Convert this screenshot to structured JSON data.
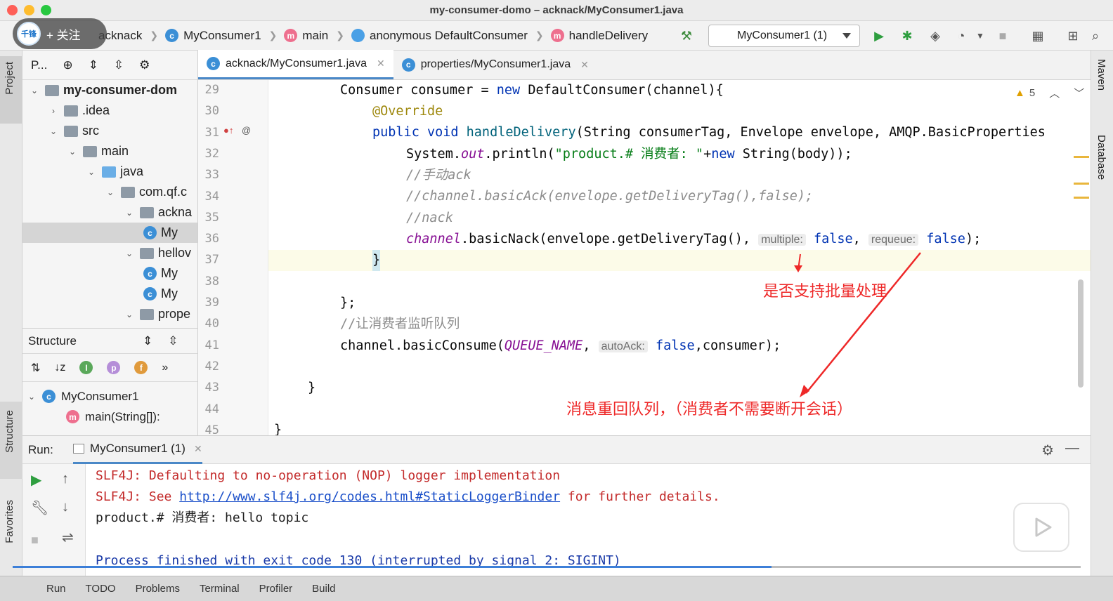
{
  "window": {
    "title": "my-consumer-domo – acknack/MyConsumer1.java"
  },
  "overlay": {
    "follow_label": "+ 关注",
    "avatar_text": "千锋"
  },
  "navbar": {
    "breadcrumbs": [
      {
        "label": "acknack",
        "icon": "folder-icon"
      },
      {
        "label": "MyConsumer1",
        "icon": "class-icon"
      },
      {
        "label": "main",
        "icon": "method-icon"
      },
      {
        "label": "anonymous DefaultConsumer",
        "icon": "anonymous-class-icon"
      },
      {
        "label": "handleDelivery",
        "icon": "method-icon"
      }
    ],
    "run_config": "MyConsumer1 (1)"
  },
  "project_panel": {
    "title": "P...",
    "tree": [
      {
        "label": "my-consumer-dom",
        "level": 0,
        "bold": true,
        "expanded": true
      },
      {
        "label": ".idea",
        "level": 1,
        "expanded": false
      },
      {
        "label": "src",
        "level": 1,
        "expanded": true
      },
      {
        "label": "main",
        "level": 2,
        "expanded": true
      },
      {
        "label": "java",
        "level": 3,
        "expanded": true
      },
      {
        "label": "com.qf.c",
        "level": 4,
        "expanded": true
      },
      {
        "label": "ackna",
        "level": 5,
        "expanded": true
      },
      {
        "label": "My",
        "level": 6,
        "file": true,
        "selected": true
      },
      {
        "label": "hellov",
        "level": 5,
        "expanded": true
      },
      {
        "label": "My",
        "level": 6,
        "file": true
      },
      {
        "label": "My",
        "level": 6,
        "file": true
      },
      {
        "label": "prope",
        "level": 5,
        "expanded": true
      }
    ]
  },
  "structure_panel": {
    "title": "Structure",
    "items": [
      {
        "label": "MyConsumer1"
      },
      {
        "label": "main(String[]):"
      }
    ]
  },
  "side_tabs": {
    "project": "Project",
    "structure": "Structure",
    "favorites": "Favorites",
    "maven": "Maven",
    "database": "Database"
  },
  "editor": {
    "tabs": [
      {
        "label": "acknack/MyConsumer1.java",
        "active": true
      },
      {
        "label": "properties/MyConsumer1.java",
        "active": false
      }
    ],
    "warnings_count": "5",
    "line_numbers": [
      "29",
      "30",
      "31",
      "32",
      "33",
      "34",
      "35",
      "36",
      "37",
      "38",
      "39",
      "40",
      "41",
      "42",
      "43",
      "44",
      "45"
    ],
    "code": {
      "l29_a": "Consumer consumer = ",
      "l29_kw": "new",
      "l29_b": " DefaultConsumer(channel){",
      "l30": "@Override",
      "l31_kw": "public void ",
      "l31_m": "handleDelivery",
      "l31_b": "(String consumerTag, Envelope envelope, AMQP.BasicProperties",
      "l32_a": "System.",
      "l32_out": "out",
      "l32_b": ".println(",
      "l32_str": "\"product.# 消费者: \"",
      "l32_c": "+",
      "l32_kw": "new",
      "l32_d": " String(body));",
      "l33": "//手动ack",
      "l34": "//channel.basicAck(envelope.getDeliveryTag(),false);",
      "l35": "//nack",
      "l36_a": "channel",
      "l36_b": ".basicNack(envelope.getDeliveryTag(), ",
      "l36_hint1": "multiple:",
      "l36_v1": "false",
      "l36_c": ", ",
      "l36_hint2": "requeue:",
      "l36_v2": "false",
      "l36_d": ");",
      "l37": "}",
      "l39": "};",
      "l40": "//让消费者监听队列",
      "l41_a": "channel.basicConsume(",
      "l41_q": "QUEUE_NAME",
      "l41_b": ", ",
      "l41_hint": "autoAck:",
      "l41_v": "false",
      "l41_c": ",consumer);",
      "l43": "}",
      "l45": "}"
    },
    "annotations": {
      "batch": "是否支持批量处理",
      "requeue": "消息重回队列，（消费者不需要断开会话）"
    }
  },
  "run_panel": {
    "label": "Run:",
    "tab": "MyConsumer1 (1)",
    "console": {
      "line1": "SLF4J: Defaulting to no-operation (NOP) logger implementation",
      "line2_a": "SLF4J: See ",
      "line2_link": "http://www.slf4j.org/codes.html#StaticLoggerBinder",
      "line2_b": " for further details.",
      "line3": "product.# 消费者: hello topic",
      "line5": "Process finished with exit code 130 (interrupted by signal 2: SIGINT)"
    }
  },
  "bottombar": {
    "items": [
      "Run",
      "TODO",
      "Problems",
      "Terminal",
      "Profiler",
      "Build"
    ]
  },
  "colors": {
    "annotation": "#ee2828",
    "keyword": "#0033b3",
    "progress": "#3d7fd8"
  }
}
